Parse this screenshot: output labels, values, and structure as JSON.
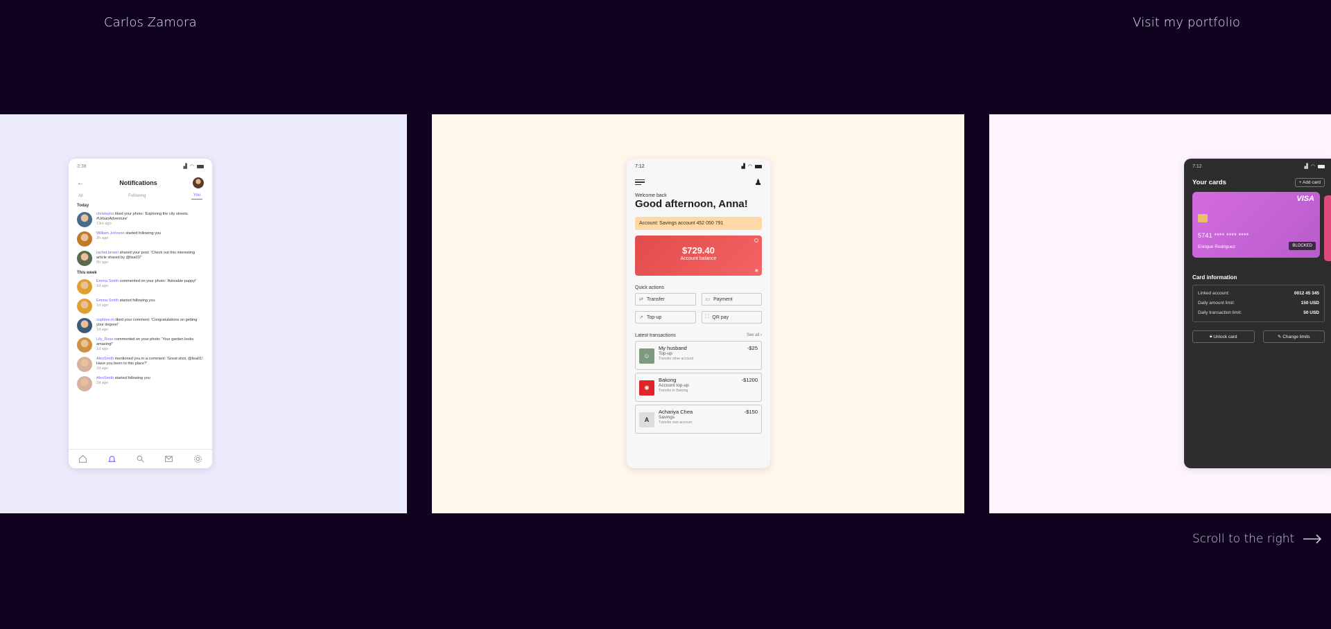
{
  "header": {
    "name": "Carlos Zamora",
    "portfolio_link": "Visit my portfolio"
  },
  "footer": {
    "scroll_hint": "Scroll to the right",
    "scroll_icon": "arrow-right-icon"
  },
  "colors": {
    "page_bg": "#10031f",
    "panel1_bg": "#ebebfc",
    "panel2_bg": "#fff7ec",
    "panel3_bg": "#fdf4fe",
    "accent_purple": "#6c63ff",
    "balance_red": "#e24b4b"
  },
  "notifications_app": {
    "status_time": "3:38",
    "title": "Notifications",
    "tabs": [
      "All",
      "Following",
      "You"
    ],
    "active_tab": "You",
    "sections": [
      {
        "label": "Today",
        "items": [
          {
            "user": "christaylor",
            "text": "liked your photo: 'Exploring the city streets. #UrbanAdventure'",
            "time": "13m ago"
          },
          {
            "user": "William Johnson",
            "text": "started following you",
            "time": "2h ago"
          },
          {
            "user": "rachel.brown",
            "text": "shared your post: 'Check out this interesting article shared by @lisa01!'",
            "time": "5h ago"
          }
        ]
      },
      {
        "label": "This week",
        "items": [
          {
            "user": "Emma Smith",
            "text": "commented on your photo: 'Adorable puppy!'",
            "time": "1d ago"
          },
          {
            "user": "Emma Smith",
            "text": "started following you",
            "time": "1d ago"
          },
          {
            "user": "sophiee.m",
            "text": "liked your comment: 'Congratulations on getting your degree!'",
            "time": "1d ago"
          },
          {
            "user": "Lily_Rose",
            "text": "commented on your photo: 'Your garden looks amazing!'",
            "time": "1d ago"
          },
          {
            "user": "AlexSmith",
            "text": "mentioned you in a comment: 'Great shot, @lisa01! Have you been to this place?'",
            "time": "2d ago"
          },
          {
            "user": "AlexSmith",
            "text": "started following you",
            "time": "2d ago"
          }
        ]
      }
    ],
    "bottom_nav": [
      "home-icon",
      "bell-icon",
      "search-icon",
      "mail-icon",
      "gear-icon"
    ]
  },
  "banking_app": {
    "status_time": "7:12",
    "welcome": "Welcome back",
    "greeting": "Good afternoon, Anna!",
    "account_label": "Account: Savings account 452 050 791",
    "balance": "$729.40",
    "balance_label": "Account balance",
    "quick_actions_label": "Quick actions",
    "quick_actions": [
      "Transfer",
      "Payment",
      "Top-up",
      "QR pay"
    ],
    "latest_label": "Latest transactions",
    "see_all": "See all",
    "transactions": [
      {
        "name": "My husband",
        "type": "Top-up",
        "desc": "Transfer other account",
        "amount": "-$25"
      },
      {
        "name": "Bakong",
        "type": "Account top-up",
        "desc": "Transfer to Bakong",
        "amount": "-$1200"
      },
      {
        "name": "Achariya Chea",
        "type": "Savings",
        "desc": "Transfer own account",
        "amount": "-$150",
        "initial": "A"
      }
    ]
  },
  "cards_app": {
    "status_time": "7:12",
    "title": "Your cards",
    "add_card": "Add card",
    "card": {
      "brand": "VISA",
      "number": "5741 **** **** ****",
      "holder": "Enrique Rodriguez",
      "status": "BLOCKED"
    },
    "info_title": "Card information",
    "info": [
      {
        "label": "Linked account:",
        "value": "0012 45 345"
      },
      {
        "label": "Daily amount limit:",
        "value": "150 USD"
      },
      {
        "label": "Daily transaction limit:",
        "value": "50 USD"
      }
    ],
    "buttons": [
      "Unlock card",
      "Change limits"
    ]
  }
}
